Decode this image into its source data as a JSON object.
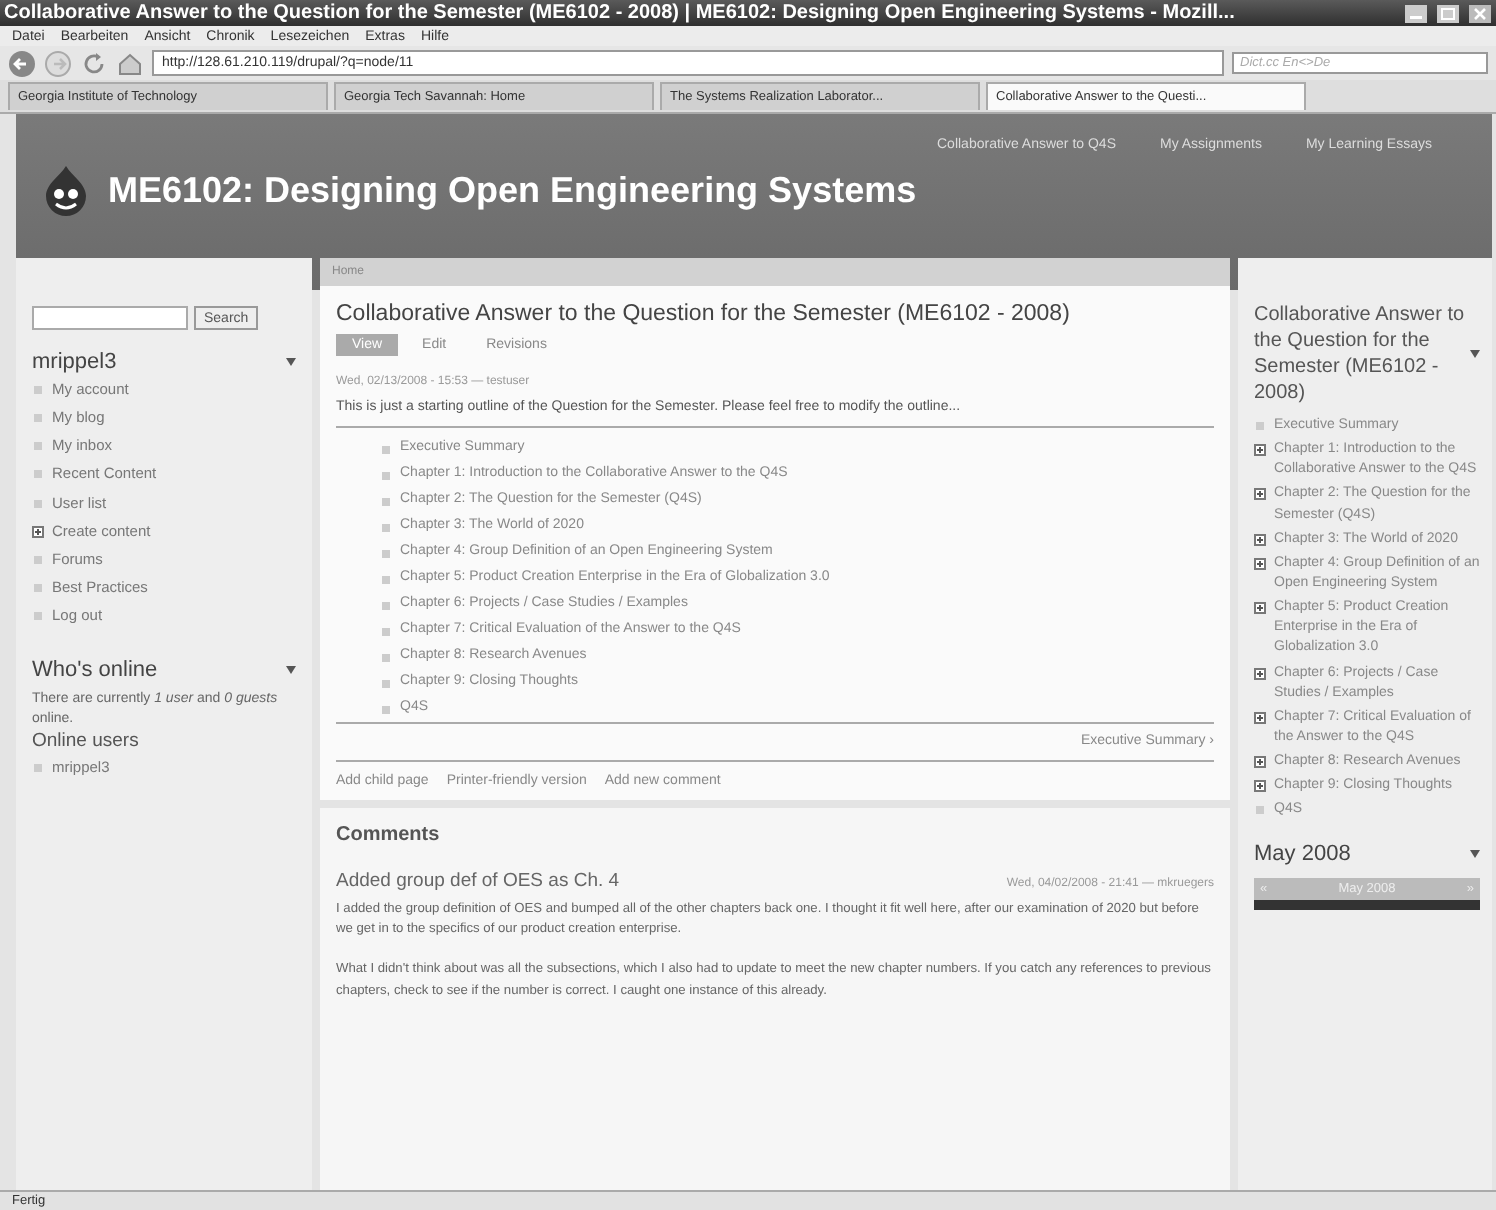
{
  "browser": {
    "title": "Collaborative Answer to the Question for the Semester (ME6102 - 2008) | ME6102: Designing Open Engineering Systems - Mozill...",
    "menu": [
      "Datei",
      "Bearbeiten",
      "Ansicht",
      "Chronik",
      "Lesezeichen",
      "Extras",
      "Hilfe"
    ],
    "address": "http://128.61.210.119/drupal/?q=node/11",
    "search_placeholder": "Dict.cc En<>De",
    "tabs": [
      {
        "label": "Georgia Institute of Technology",
        "selected": false
      },
      {
        "label": "Georgia Tech Savannah: Home",
        "selected": false
      },
      {
        "label": "The Systems Realization Laborator...",
        "selected": false
      },
      {
        "label": "Collaborative Answer to the Questi...",
        "selected": true
      }
    ],
    "status": "Fertig"
  },
  "site": {
    "name": "ME6102: Designing Open Engineering Systems",
    "primary_links": [
      "Collaborative Answer to Q4S",
      "My Assignments",
      "My Learning Essays"
    ]
  },
  "left": {
    "search_button": "Search",
    "user_block": {
      "title": "mrippel3",
      "items": [
        {
          "label": "My account",
          "kind": "leaf"
        },
        {
          "label": "My blog",
          "kind": "leaf"
        },
        {
          "label": "My inbox",
          "kind": "leaf"
        },
        {
          "label": "Recent Content",
          "kind": "leaf"
        },
        {
          "label": "User list",
          "kind": "leaf"
        },
        {
          "label": "Create content",
          "kind": "collapsed"
        },
        {
          "label": "Forums",
          "kind": "leaf"
        },
        {
          "label": "Best Practices",
          "kind": "leaf"
        },
        {
          "label": "Log out",
          "kind": "leaf"
        }
      ]
    },
    "whos_online": {
      "title": "Who's online",
      "text": "There are currently *1 user* and *0 guests* online.",
      "subtitle": "Online users",
      "users": [
        "mrippel3"
      ]
    }
  },
  "node": {
    "breadcrumb": "Home",
    "title": "Collaborative Answer to the Question for the Semester (ME6102 - 2008)",
    "tabs": [
      {
        "label": "View",
        "selected": true
      },
      {
        "label": "Edit",
        "selected": false
      },
      {
        "label": "Revisions",
        "selected": false
      }
    ],
    "meta": "Wed, 02/13/2008 - 15:53 — testuser",
    "body": "This is just a starting outline of the Question for the Semester. Please feel free to modify the outline...",
    "book_outline": [
      "Executive Summary",
      "Chapter 1: Introduction to the Collaborative Answer to the Q4S",
      "Chapter 2: The Question for the Semester (Q4S)",
      "Chapter 3: The World of 2020",
      "Chapter 4: Group Definition of an Open Engineering System",
      "Chapter 5: Product Creation Enterprise in the Era of Globalization 3.0",
      "Chapter 6: Projects / Case Studies / Examples",
      "Chapter 7: Critical Evaluation of the Answer to the Q4S",
      "Chapter 8: Research Avenues",
      "Chapter 9: Closing Thoughts",
      "Q4S"
    ],
    "next_link": "Executive Summary ›",
    "links": [
      "Add child page",
      "Printer-friendly version",
      "Add new comment"
    ],
    "comments_heading": "Comments",
    "comments": [
      {
        "title": "Added group def of OES as Ch. 4",
        "meta": "Wed, 04/02/2008 - 21:41 — mkruegers",
        "paragraphs": [
          "I added the group definition of OES and bumped all of the other chapters back one. I thought it fit well here, after our examination of 2020 but before we get in to the specifics of our product creation enterprise.",
          "What I didn't think about was all the subsections, which I also had to update to meet the new chapter numbers. If you catch any references to previous chapters, check to see if the number is correct. I caught one instance of this already."
        ]
      }
    ]
  },
  "right": {
    "book_nav": {
      "title": "Collaborative Answer to the Question for the Semester (ME6102 - 2008)",
      "items": [
        {
          "label": "Executive Summary",
          "kind": "leaf"
        },
        {
          "label": "Chapter 1: Introduction to the Collaborative Answer to the Q4S",
          "kind": "collapsed"
        },
        {
          "label": "Chapter 2: The Question for the Semester (Q4S)",
          "kind": "collapsed"
        },
        {
          "label": "Chapter 3: The World of 2020",
          "kind": "collapsed"
        },
        {
          "label": "Chapter 4: Group Definition of an Open Engineering System",
          "kind": "collapsed"
        },
        {
          "label": "Chapter 5: Product Creation Enterprise in the Era of Globalization 3.0",
          "kind": "collapsed"
        },
        {
          "label": "Chapter 6: Projects / Case Studies / Examples",
          "kind": "collapsed"
        },
        {
          "label": "Chapter 7: Critical Evaluation of the Answer to the Q4S",
          "kind": "collapsed"
        },
        {
          "label": "Chapter 8: Research Avenues",
          "kind": "collapsed"
        },
        {
          "label": "Chapter 9: Closing Thoughts",
          "kind": "collapsed"
        },
        {
          "label": "Q4S",
          "kind": "leaf"
        }
      ]
    },
    "calendar": {
      "title": "May 2008",
      "prev": "«",
      "month": "May 2008",
      "next": "»"
    }
  }
}
